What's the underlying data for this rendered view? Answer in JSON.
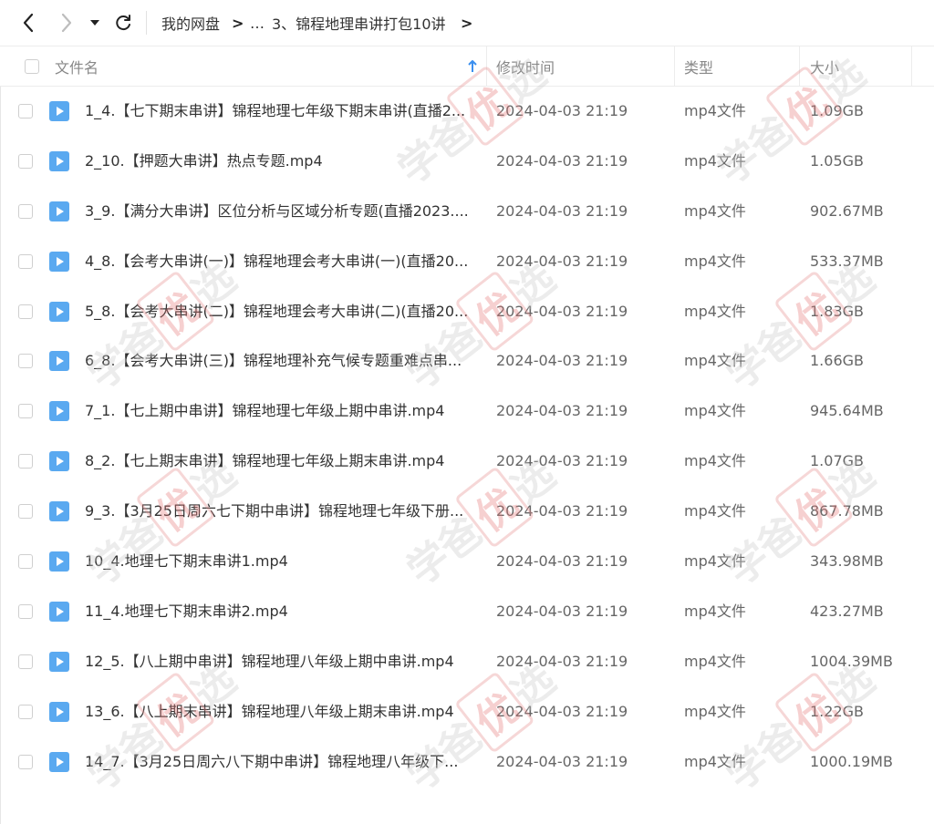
{
  "nav": {
    "back_icon": "chevron-left-icon",
    "forward_icon": "chevron-right-icon",
    "dropdown_icon": "caret-down-icon",
    "refresh_icon": "refresh-icon"
  },
  "breadcrumb": {
    "root": "我的网盘",
    "ellipsis": "…",
    "current": "3、锦程地理串讲打包10讲",
    "separator": ">"
  },
  "columns": {
    "name": "文件名",
    "modified": "修改时间",
    "type": "类型",
    "size": "大小",
    "sort_icon": "sort-arrow-up-icon"
  },
  "files": [
    {
      "name": "1_4.【七下期末串讲】锦程地理七年级下期末串讲(直播2...",
      "modified": "2024-04-03 21:19",
      "type": "mp4文件",
      "size": "1.09GB"
    },
    {
      "name": "2_10.【押题大串讲】热点专题.mp4",
      "modified": "2024-04-03 21:19",
      "type": "mp4文件",
      "size": "1.05GB"
    },
    {
      "name": "3_9.【满分大串讲】区位分析与区域分析专题(直播2023....",
      "modified": "2024-04-03 21:19",
      "type": "mp4文件",
      "size": "902.67MB"
    },
    {
      "name": "4_8.【会考大串讲(一)】锦程地理会考大串讲(一)(直播20...",
      "modified": "2024-04-03 21:19",
      "type": "mp4文件",
      "size": "533.37MB"
    },
    {
      "name": "5_8.【会考大串讲(二)】锦程地理会考大串讲(二)(直播20...",
      "modified": "2024-04-03 21:19",
      "type": "mp4文件",
      "size": "1.83GB"
    },
    {
      "name": "6_8.【会考大串讲(三)】锦程地理补充气候专题重难点串...",
      "modified": "2024-04-03 21:19",
      "type": "mp4文件",
      "size": "1.66GB"
    },
    {
      "name": "7_1.【七上期中串讲】锦程地理七年级上期中串讲.mp4",
      "modified": "2024-04-03 21:19",
      "type": "mp4文件",
      "size": "945.64MB"
    },
    {
      "name": "8_2.【七上期末串讲】锦程地理七年级上期末串讲.mp4",
      "modified": "2024-04-03 21:19",
      "type": "mp4文件",
      "size": "1.07GB"
    },
    {
      "name": "9_3.【3月25日周六七下期中串讲】锦程地理七年级下册...",
      "modified": "2024-04-03 21:19",
      "type": "mp4文件",
      "size": "867.78MB"
    },
    {
      "name": "10_4.地理七下期末串讲1.mp4",
      "modified": "2024-04-03 21:19",
      "type": "mp4文件",
      "size": "343.98MB"
    },
    {
      "name": "11_4.地理七下期末串讲2.mp4",
      "modified": "2024-04-03 21:19",
      "type": "mp4文件",
      "size": "423.27MB"
    },
    {
      "name": "12_5.【八上期中串讲】锦程地理八年级上期中串讲.mp4",
      "modified": "2024-04-03 21:19",
      "type": "mp4文件",
      "size": "1004.39MB"
    },
    {
      "name": "13_6.【八上期末串讲】锦程地理八年级上期末串讲.mp4",
      "modified": "2024-04-03 21:19",
      "type": "mp4文件",
      "size": "1.22GB"
    },
    {
      "name": "14_7.【3月25日周六八下期中串讲】锦程地理八年级下...",
      "modified": "2024-04-03 21:19",
      "type": "mp4文件",
      "size": "1000.19MB"
    }
  ],
  "watermark": {
    "text_a": "学爸",
    "text_b": "优",
    "text_c": "选"
  },
  "colors": {
    "accent": "#4a9ff5",
    "file_icon": "#5aa9f0"
  }
}
